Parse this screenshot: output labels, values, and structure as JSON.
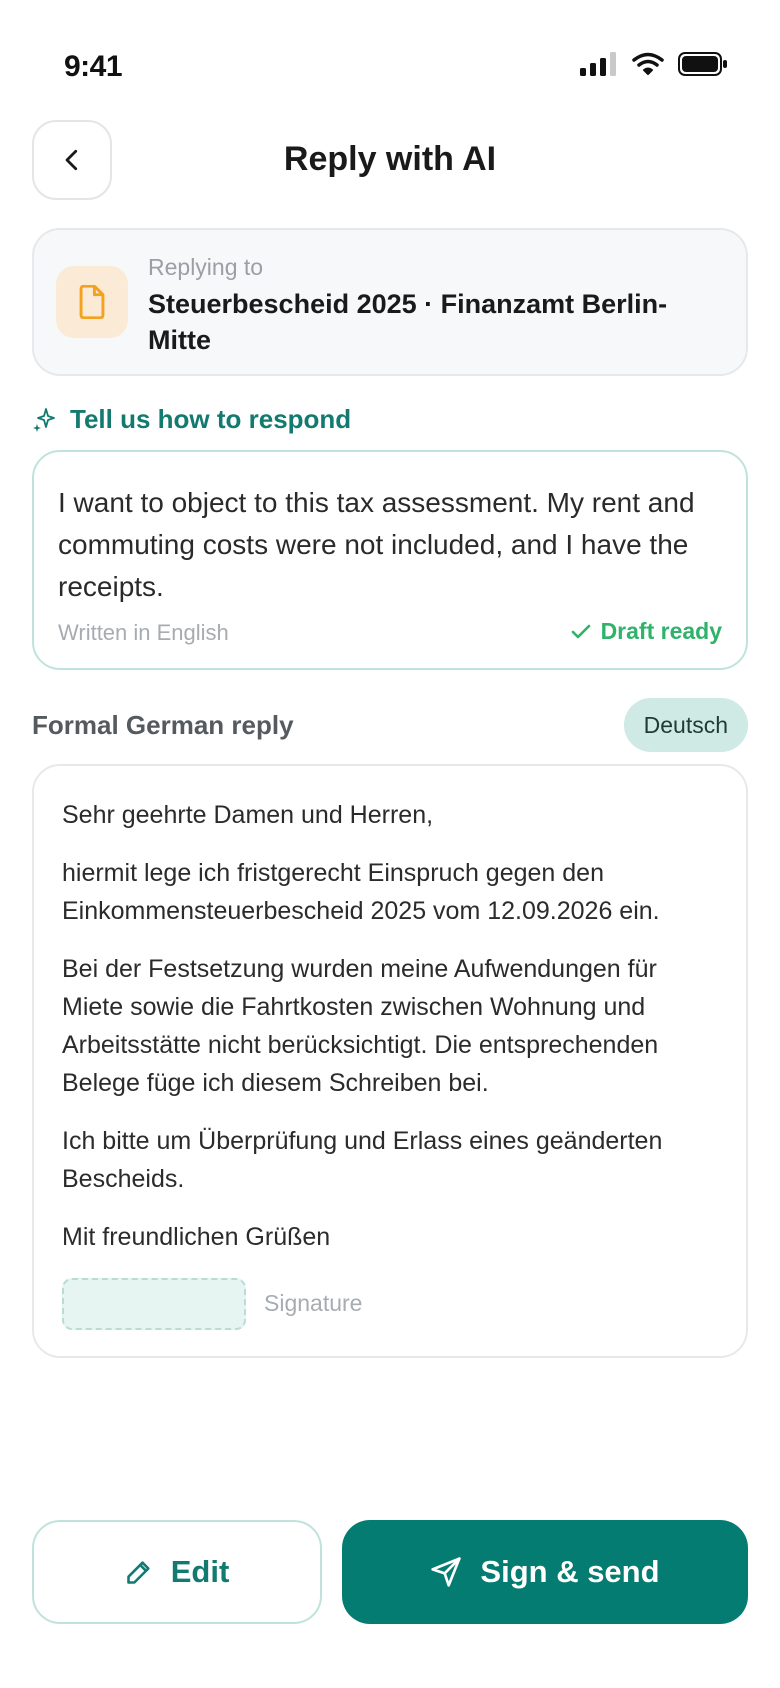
{
  "status_bar": {
    "time": "9:41"
  },
  "header": {
    "title": "Reply with AI"
  },
  "reply_context": {
    "label": "Replying to",
    "subject": "Steuerbescheid 2025 · Finanzamt Berlin-Mitte"
  },
  "prompt": {
    "heading": "Tell us how to respond",
    "text": "I want to object to this tax assessment. My rent and commuting costs were not included, and I have the receipts.",
    "language_note": "Written in English",
    "status": "Draft ready"
  },
  "reply": {
    "heading": "Formal German reply",
    "language_badge": "Deutsch",
    "paragraphs": [
      "Sehr geehrte Damen und Herren,",
      "hiermit lege ich fristgerecht Einspruch gegen den Einkommensteuerbescheid 2025 vom 12.09.2026 ein.",
      "Bei der Festsetzung wurden meine Aufwendungen für Miete sowie die Fahrtkosten zwischen Wohnung und Arbeitsstätte nicht berücksichtigt. Die entsprechenden Belege füge ich diesem Schreiben bei.",
      "Ich bitte um Überprüfung und Erlass eines geänderten Bescheids.",
      "Mit freundlichen Grüßen"
    ],
    "signature_label": "Signature"
  },
  "actions": {
    "edit_label": "Edit",
    "send_label": "Sign & send"
  },
  "colors": {
    "brand": "#057c72",
    "brand_text": "#137a6f",
    "success": "#2fb36a",
    "doc_icon": "#f3a11f"
  },
  "icons": {
    "back": "chevron-left-icon",
    "document": "document-icon",
    "prompt": "sparkle-icon",
    "status": "check-icon",
    "edit": "pencil-icon",
    "send": "paper-plane-icon"
  }
}
